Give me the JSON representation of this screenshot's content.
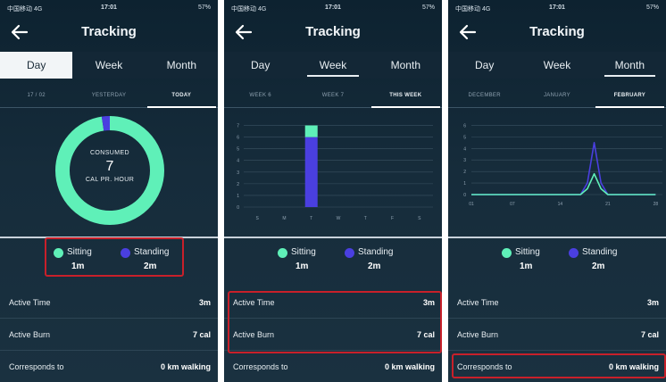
{
  "status": {
    "carrier": "中国移动 4G",
    "time": "17:01",
    "battery": "57%"
  },
  "colors": {
    "sitting": "#5ff0b8",
    "standing": "#4a3fe0",
    "accent_box": "#c8202a"
  },
  "icons": {
    "back": "back-arrow-icon"
  },
  "panels": [
    {
      "title": "Tracking",
      "tabs": [
        "Day",
        "Week",
        "Month"
      ],
      "active_tab": 0,
      "subtabs": [
        "17 / 02",
        "YESTERDAY",
        "TODAY"
      ],
      "active_subtab": 2,
      "donut": {
        "label_top": "CONSUMED",
        "value": "7",
        "label_bottom": "CAL PR. HOUR",
        "sitting_share": 0.975,
        "standing_share": 0.025
      },
      "legend": [
        {
          "name": "Sitting",
          "value": "1m"
        },
        {
          "name": "Standing",
          "value": "2m"
        }
      ],
      "stats": [
        {
          "label": "Active Time",
          "value": "3m"
        },
        {
          "label": "Active Burn",
          "value": "7 cal"
        },
        {
          "label": "Corresponds to",
          "value": "0 km walking"
        }
      ]
    },
    {
      "title": "Tracking",
      "tabs": [
        "Day",
        "Week",
        "Month"
      ],
      "active_tab": 1,
      "subtabs": [
        "WEEK 6",
        "WEEK 7",
        "THIS WEEK"
      ],
      "active_subtab": 2,
      "legend": [
        {
          "name": "Sitting",
          "value": "1m"
        },
        {
          "name": "Standing",
          "value": "2m"
        }
      ],
      "stats": [
        {
          "label": "Active Time",
          "value": "3m"
        },
        {
          "label": "Active Burn",
          "value": "7 cal"
        },
        {
          "label": "Corresponds to",
          "value": "0 km walking"
        }
      ]
    },
    {
      "title": "Tracking",
      "tabs": [
        "Day",
        "Week",
        "Month"
      ],
      "active_tab": 2,
      "subtabs": [
        "DECEMBER",
        "JANUARY",
        "FEBRUARY"
      ],
      "active_subtab": 2,
      "legend": [
        {
          "name": "Sitting",
          "value": "1m"
        },
        {
          "name": "Standing",
          "value": "2m"
        }
      ],
      "stats": [
        {
          "label": "Active Time",
          "value": "3m"
        },
        {
          "label": "Active Burn",
          "value": "7 cal"
        },
        {
          "label": "Corresponds to",
          "value": "0 km walking"
        }
      ]
    }
  ],
  "chart_data": [
    {
      "type": "bar",
      "categories": [
        "S",
        "M",
        "T",
        "W",
        "T",
        "F",
        "S"
      ],
      "series": [
        {
          "name": "Standing",
          "values": [
            0,
            0,
            6,
            0,
            0,
            0,
            0
          ]
        },
        {
          "name": "Sitting",
          "values": [
            0,
            0,
            1,
            0,
            0,
            0,
            0
          ]
        }
      ],
      "stacked": true,
      "yticks": [
        0,
        1,
        2,
        3,
        4,
        5,
        6,
        7
      ],
      "ylim": [
        0,
        7.5
      ]
    },
    {
      "type": "line",
      "xticks": [
        "01",
        "07",
        "14",
        "21",
        "28"
      ],
      "x": [
        1,
        17,
        18,
        19,
        20,
        21,
        28
      ],
      "series": [
        {
          "name": "Standing",
          "values": [
            0,
            0,
            1,
            4.5,
            1,
            0,
            0
          ]
        },
        {
          "name": "Sitting",
          "values": [
            0,
            0,
            0.5,
            1.8,
            0.5,
            0,
            0
          ]
        }
      ],
      "yticks": [
        0,
        1,
        2,
        3,
        4,
        5,
        6
      ],
      "ylim": [
        0,
        6.5
      ],
      "xlim": [
        1,
        29
      ]
    }
  ]
}
